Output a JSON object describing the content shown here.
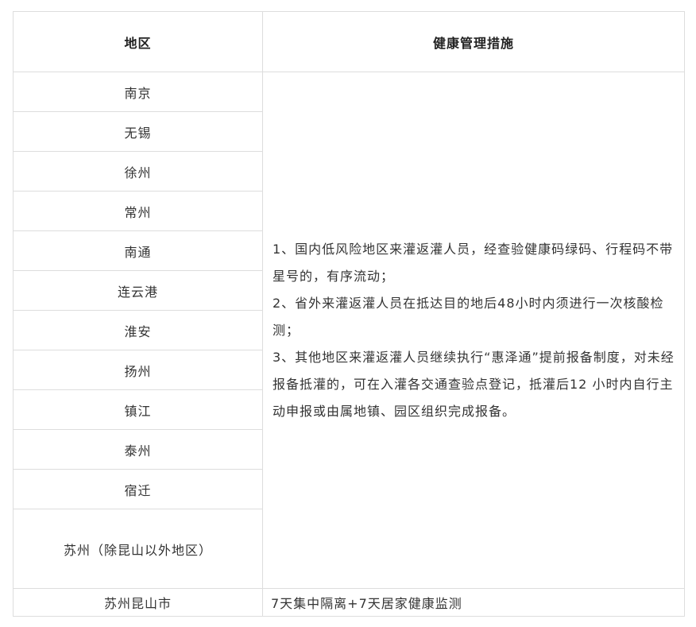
{
  "header": {
    "col1": "地区",
    "col2": "健康管理措施"
  },
  "regions": [
    "南京",
    "无锡",
    "徐州",
    "常州",
    "南通",
    "连云港",
    "淮安",
    "扬州",
    "镇江",
    "泰州",
    "宿迁",
    "苏州（除昆山以外地区）"
  ],
  "measures": [
    "1、国内低风险地区来灌返灌人员，经查验健康码绿码、行程码不带星号的，有序流动；",
    "2、省外来灌返灌人员在抵达目的地后48小时内须进行一次核酸检测；",
    "3、其他地区来灌返灌人员继续执行“惠泽通”提前报备制度，对未经报备抵灌的，可在入灌各交通查验点登记，抵灌后12 小时内自行主动申报或由属地镇、园区组织完成报备。"
  ],
  "last_row": {
    "region": "苏州昆山市",
    "measure": "7天集中隔离+7天居家健康监测"
  }
}
